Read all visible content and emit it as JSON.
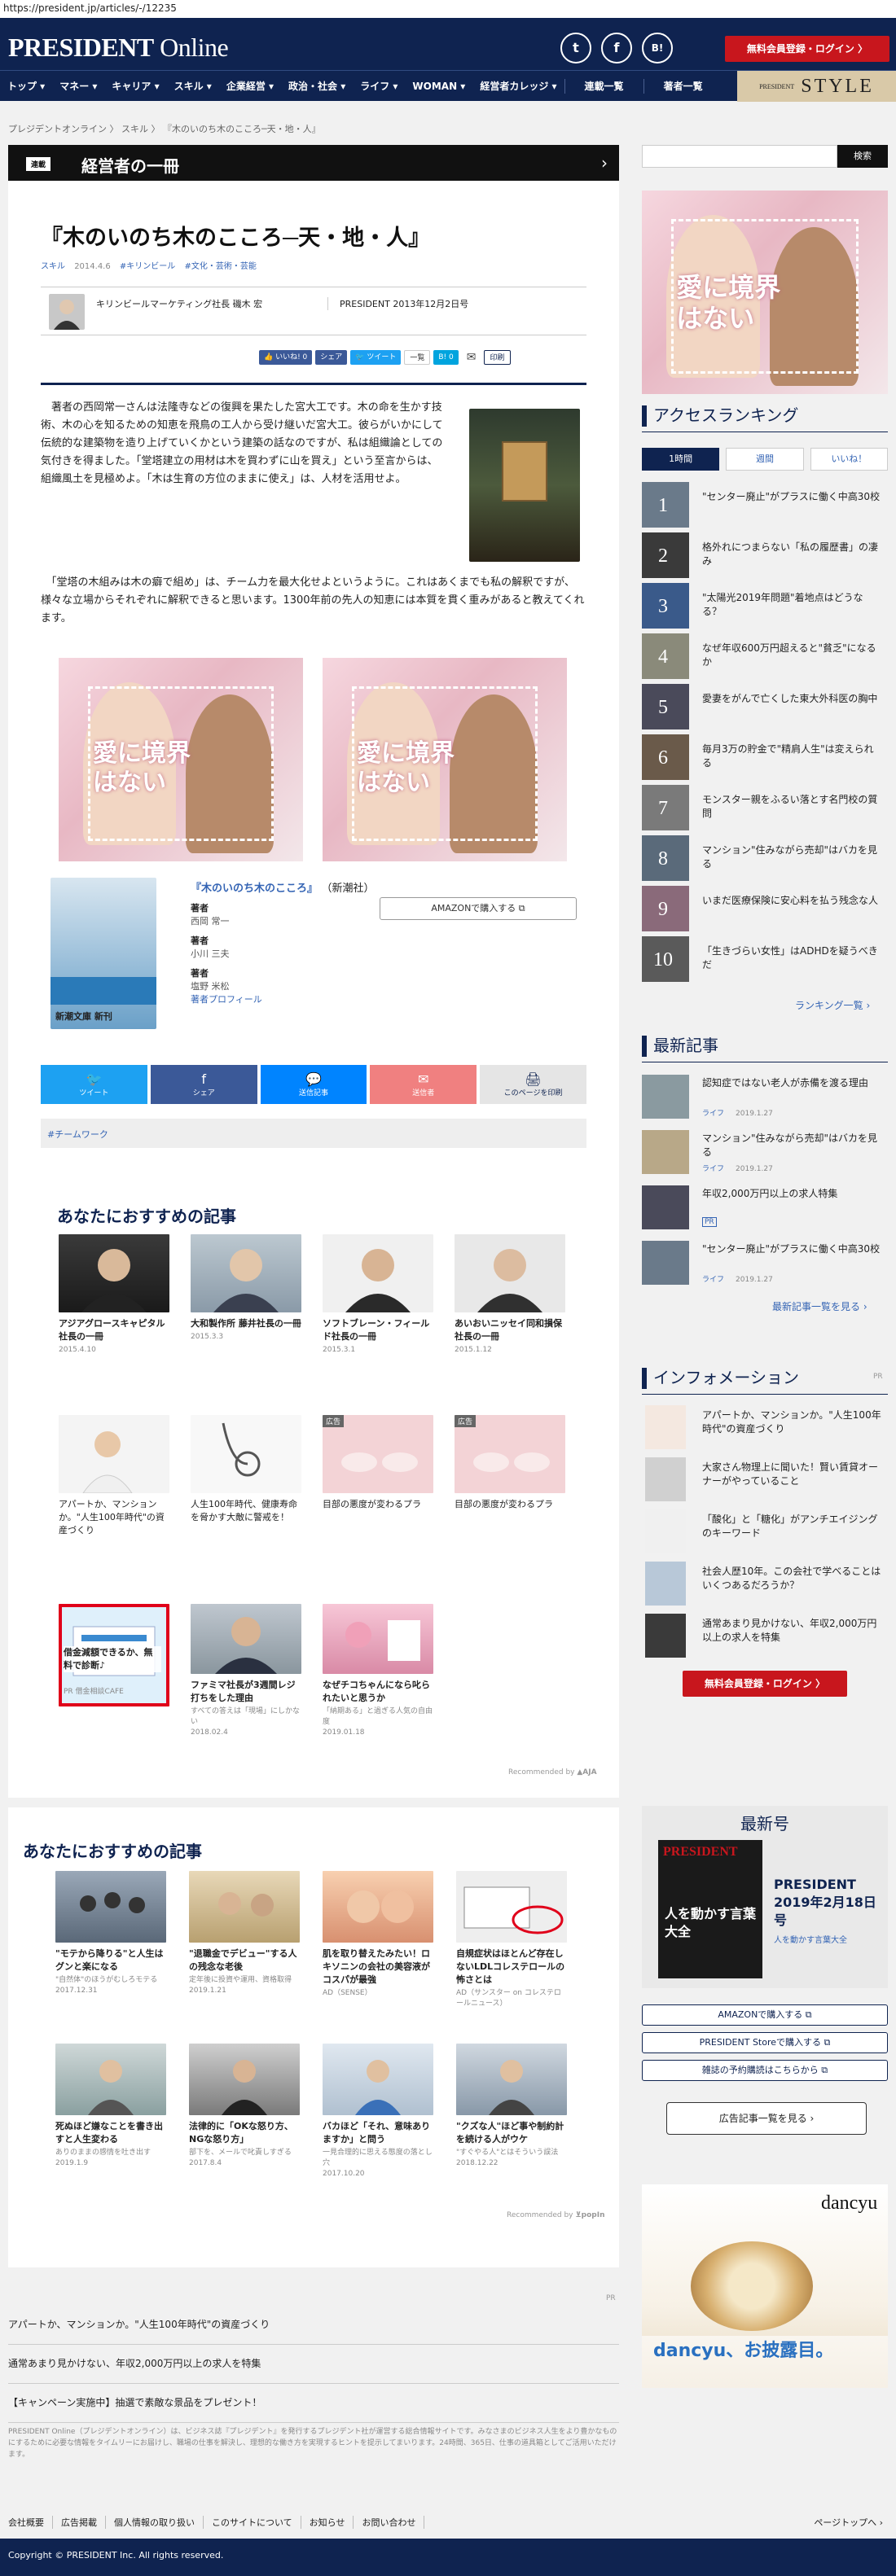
{
  "url": "https://president.jp/articles/-/12235",
  "header": {
    "logo_bold": "PRESIDENT",
    "logo_rest": " Online",
    "social": [
      "t",
      "f",
      "B!"
    ],
    "login": "無料会員登録・ログイン  〉"
  },
  "nav": {
    "items": [
      "トップ ▾",
      "マネー ▾",
      "キャリア ▾",
      "スキル ▾",
      "企業経営 ▾",
      "政治・社会 ▾",
      "ライフ ▾",
      "WOMAN ▾",
      "経営者カレッジ ▾"
    ],
    "extra": [
      "連載一覧",
      "著者一覧"
    ],
    "style_small": "PRESIDENT",
    "style": "STYLE"
  },
  "breadcrumb": "プレジデントオンライン  〉  スキル  〉  『木のいのち木のこころ─天・地・人』",
  "series": {
    "tag": "連載",
    "name": "経営者の一冊",
    "arrow": "›"
  },
  "article": {
    "title": "『木のいのち木のこころ─天・地・人』",
    "tags": [
      "スキル",
      "2014.4.6",
      "#キリンビール",
      "#文化・芸術・芸能"
    ],
    "author": "キリンビールマーケティング社長  磯木  宏",
    "published": "PRESIDENT 2013年12月2日号",
    "share": [
      {
        "label": "👍 いいね! 0",
        "color": "#3b5998"
      },
      {
        "label": "シェア",
        "color": "#3b5998"
      },
      {
        "label": "🐦 ツイート",
        "color": "#1da1f2"
      },
      {
        "label": "一覧",
        "color": "#888"
      },
      {
        "label": "B! 0",
        "color": "#00a4de"
      },
      {
        "label": "✉",
        "color": "#666"
      },
      {
        "label": "印刷",
        "color": "#0f2350"
      }
    ],
    "body1": "　著者の西岡常一さんは法隆寺などの復興を果たした宮大工です。木の命を生かす技術、木の心を知るための知恵を飛鳥の工人から受け継いだ宮大工。彼らがいかにして伝統的な建築物を造り上げていくかという建築の話なのですが、私は組織論としての気付きを得ました。「堂塔建立の用材は木を買わずに山を買え」という至言からは、組織風土を見極めよ。「木は生育の方位のままに使え」は、人材を活用せよ。",
    "body2": "　「堂塔の木組みは木の癖で組め」は、チーム力を最大化せよというように。これはあくまでも私の解釈ですが、様々な立場からそれぞれに解釈できると思います。1300年前の先人の知恵には本質を貫く重みがあると教えてくれます。",
    "ad_text": "愛に境界はない",
    "book": {
      "title": "『木のいのち木のこころ』",
      "publisher": "（新潮社）",
      "labels": [
        "著者",
        "著者",
        "著者"
      ],
      "authors": [
        "西岡  常一",
        "小川  三夫",
        "塩野  米松"
      ],
      "profile": "著者プロフィール",
      "amazon": "AMAZONで購入する  ⧉",
      "cover_text": "新潮文庫 新刊"
    },
    "share_big": [
      {
        "icon": "🐦",
        "label": "ツイート",
        "color": "#1da1f2"
      },
      {
        "icon": "f",
        "label": "シェア",
        "color": "#3b5998"
      },
      {
        "icon": "💬",
        "label": "送信記事",
        "color": "#0084ff"
      },
      {
        "icon": "✉",
        "label": "送信者",
        "color": "#f08080"
      },
      {
        "icon": "🖨",
        "label": "このページを印刷",
        "color": "#e5e5e5"
      }
    ],
    "hashtag": "#チームワーク"
  },
  "rec1": {
    "title": "あなたにおすすめの記事",
    "row1": [
      {
        "title": "アジアグロースキャピタル社長の一冊",
        "date": "2015.4.10"
      },
      {
        "title": "大和製作所 藤井社長の一冊",
        "date": "2015.3.3"
      },
      {
        "title": "ソフトブレーン・フィールド社長の一冊",
        "date": "2015.3.1"
      },
      {
        "title": "あいおいニッセイ同和損保社長の一冊",
        "date": "2015.1.12"
      }
    ],
    "row2": [
      {
        "title": "アパートか、マンションか。\"人生100年時代\"の資産づくり",
        "ad": "",
        "src": ""
      },
      {
        "title": "人生100年時代、健康寿命を脅かす大敵に警戒を！",
        "ad": "",
        "src": ""
      },
      {
        "title": "目部の悪度が変わるプラ",
        "ad": "広告",
        "src": ""
      },
      {
        "title": "目部の悪度が変わるプラ",
        "ad": "広告",
        "src": ""
      }
    ],
    "row3": [
      {
        "title": "借金減額できるか、無料で診断♪",
        "src": "PR 借金相談CAFE",
        "date": ""
      },
      {
        "title": "ファミマ社長が3週間レジ打ちをした理由",
        "src": "すべての答えは「現場」にしかない",
        "date": "2018.02.4"
      },
      {
        "title": "なぜチコちゃんになら叱られたいと思うか",
        "src": "「納期ある」と過ぎる人気の自由度",
        "date": "2019.01.18"
      }
    ],
    "by": "Recommended by",
    "by_brand": "▲AJA"
  },
  "rec2": {
    "title": "あなたにおすすめの記事",
    "row1": [
      {
        "title": "\"モテから降りる\"と人生はグンと楽になる",
        "src": "\"自然体\"のほうがむしろモテる",
        "date": "2017.12.31"
      },
      {
        "title": "\"退職金でデビュー\"する人の残念な老後",
        "src": "定年後に投資や運用、資格取得",
        "date": "2019.1.21"
      },
      {
        "title": "肌を取り替えたみたい！ロキソニンの会社の美容液がコスパが最強",
        "src": "AD（SENSE）",
        "date": ""
      },
      {
        "title": "自規症状はほとんど存在しないLDLコレステロールの怖さとは",
        "src": "AD（サンスター on コレステロールニュース）",
        "date": ""
      }
    ],
    "row2": [
      {
        "title": "死ぬほど嫌なことを書き出すと人生変わる",
        "src": "ありのままの感情を吐き出す",
        "date": "2019.1.9"
      },
      {
        "title": "法律的に「OKな怒り方、NGな怒り方」",
        "src": "部下を、メールで叱責しすぎる",
        "date": "2017.8.4"
      },
      {
        "title": "バカほど「それ、意味ありますか」と問う",
        "src": "一見合理的に思える態度の落とし穴",
        "date": "2017.10.20"
      },
      {
        "title": "\"クズな人\"ほど事や制約計を続ける人がウケ",
        "src": "\"すぐやる人\"とはそういう誤法",
        "date": "2018.12.22"
      }
    ],
    "by": "Recommended by",
    "by_brand": "⊻popIn"
  },
  "bottom": {
    "pr": "PR",
    "items": [
      "アパートか、マンションか。\"人生100年時代\"の資産づくり",
      "通常あまり見かけない、年収2,000万円以上の求人を特集",
      "【キャンペーン実施中】抽選で素敵な景品をプレゼント！"
    ]
  },
  "disclaimer": "PRESIDENT Online（プレジデントオンライン）は、ビジネス誌『プレジデント』を発行するプレジデント社が運営する総合情報サイトです。みなさまのビジネス人生をより豊かなものにするために必要な情報をタイムリーにお届けし、職場の仕事を解決し、理想的な働き方を実現するヒントを提示してまいります。24時間、365日、仕事の道具箱としてご活用いただけます。",
  "footer": {
    "links": [
      "会社概要",
      "広告掲載",
      "個人情報の取り扱い",
      "このサイトについて",
      "お知らせ",
      "お問い合わせ"
    ],
    "pagetop": "ページトップへ ›",
    "copyright": "Copyright © PRESIDENT Inc. All rights reserved."
  },
  "side": {
    "search_btn": "検索",
    "ranking": {
      "title": "アクセスランキング",
      "tabs": [
        "1時間",
        "週間",
        "いいね！"
      ],
      "items": [
        "\"センター廃止\"がプラスに働く中高30校",
        "格外れにつまらない「私の履歴書」の凄み",
        "\"太陽光2019年問題\"着地点はどうなる？",
        "なぜ年収600万円超えると\"貧乏\"になるか",
        "愛妻をがんで亡くした東大外科医の胸中",
        "毎月3万の貯金で\"精肩人生\"は変えられる",
        "モンスター親をふるい落とす名門校の質問",
        "マンション\"住みながら売却\"はバカを見る",
        "いまだ医療保険に安心料を払う残念な人",
        "「生きづらい女性」はADHDを疑うべきだ"
      ],
      "nums": [
        "1",
        "2",
        "3",
        "4",
        "5",
        "6",
        "7",
        "8",
        "9",
        "10"
      ],
      "more": "ランキング一覧  ›"
    },
    "latest": {
      "title": "最新記事",
      "items": [
        {
          "title": "認知症ではない老人が赤備を渡る理由",
          "cat": "ライフ",
          "date": "2019.1.27"
        },
        {
          "title": "マンション\"住みながら売却\"はバカを見る",
          "cat": "ライフ",
          "date": "2019.1.27"
        },
        {
          "title": "年収2,000万円以上の求人特集",
          "cat": "PR",
          "date": ""
        },
        {
          "title": "\"センター廃止\"がプラスに働く中高30校",
          "cat": "ライフ",
          "date": "2019.1.27"
        }
      ],
      "more": "最新記事一覧を見る  ›"
    },
    "info": {
      "title": "インフォメーション",
      "pr": "PR",
      "items": [
        "アパートか、マンションか。\"人生100年時代\"の資産づくり",
        "大家さん物理上に聞いた！賢い賃貸オーナーがやっていること",
        "「酸化」と「糖化」がアンチエイジングのキーワード",
        "社会人歴10年。この会社で学べることはいくつあるだろうか？",
        "通常あまり見かけない、年収2,000万円以上の求人を特集"
      ],
      "login": "無料会員登録・ログイン  〉"
    },
    "magazine": {
      "title": "最新号",
      "cover_logo": "PRESIDENT",
      "cover_big": "人を動かす言葉大全",
      "name": "PRESIDENT 2019年2月18日号",
      "sub": "人を動かす言葉大全",
      "buttons": [
        "AMAZONで購入する  ⧉",
        "PRESIDENT Storeで購入する  ⧉",
        "雑誌の予約購読はこちらから  ⧉"
      ],
      "ad_list": "広告記事一覧を見る  ›"
    },
    "dancyu": {
      "logo": "dancyu",
      "text": "dancyu、お披露目。"
    }
  }
}
